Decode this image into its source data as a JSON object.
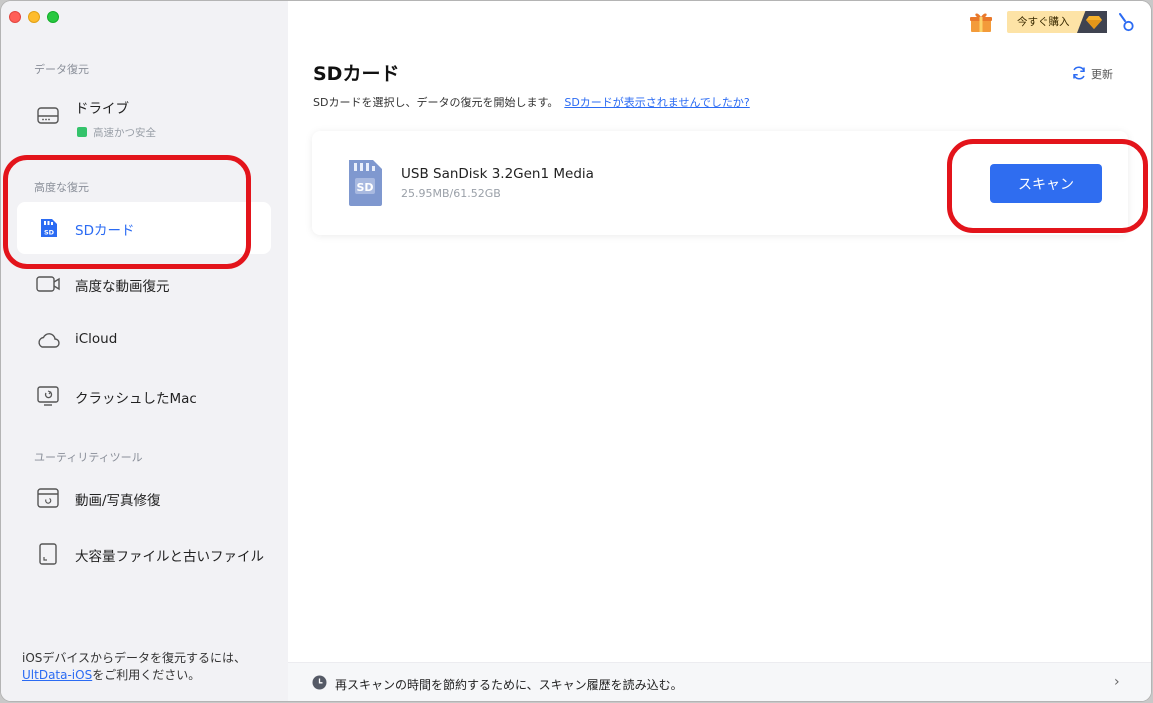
{
  "window": {
    "controls": [
      "close",
      "minimize",
      "zoom"
    ]
  },
  "sidebar": {
    "sections": [
      {
        "label": "データ復元",
        "items": [
          {
            "label": "ドライブ",
            "icon": "drive-icon",
            "sub": "高速かつ安全"
          }
        ]
      },
      {
        "label": "高度な復元",
        "items": [
          {
            "label": "SDカード",
            "icon": "sd-card-icon",
            "active": true
          },
          {
            "label": "高度な動画復元",
            "icon": "video-camera-icon"
          },
          {
            "label": "iCloud",
            "icon": "cloud-icon"
          },
          {
            "label": "クラッシュしたMac",
            "icon": "crashed-mac-icon"
          }
        ]
      },
      {
        "label": "ユーティリティツール",
        "items": [
          {
            "label": "動画/写真修復",
            "icon": "media-repair-icon"
          },
          {
            "label": "大容量ファイルと古いファイル",
            "icon": "file-icon"
          }
        ]
      }
    ],
    "footer": {
      "line1": "iOSデバイスからデータを復元するには、",
      "link": "UltData-iOS",
      "line2_suffix": "をご利用ください。"
    }
  },
  "header": {
    "buy_label": "今すぐ購入",
    "icons": [
      "gift-icon",
      "gem-icon",
      "account-icon"
    ]
  },
  "main": {
    "title": "SDカード",
    "refresh_label": "更新",
    "description": "SDカードを選択し、データの復元を開始します。",
    "help_link": "SDカードが表示されませんでしたか?",
    "device": {
      "name": "USB SanDisk 3.2Gen1 Media",
      "size": "25.95MB/61.52GB",
      "scan_label": "スキャン"
    }
  },
  "bottom_bar": {
    "text": "再スキャンの時間を節約するために、スキャン履歴を読み込む。"
  },
  "colors": {
    "accent": "#2f6df0",
    "link": "#2b6bf3",
    "annotation": "#e3141b",
    "sidebar_bg": "#f2f2f5",
    "buy_bg": "#fde3a6"
  }
}
